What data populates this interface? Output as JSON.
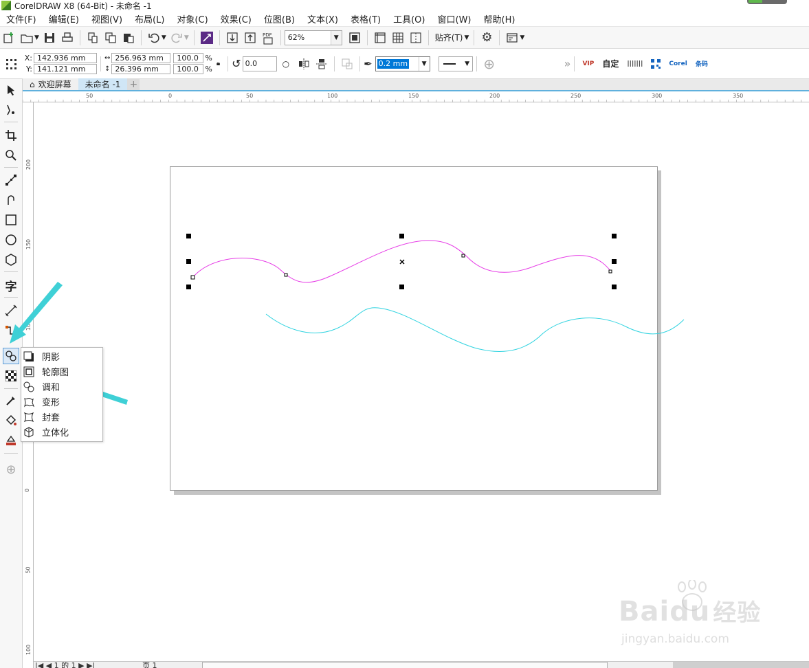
{
  "window": {
    "title": "CorelDRAW X8 (64-Bit) - 未命名 -1"
  },
  "menu": [
    "文件(F)",
    "编辑(E)",
    "视图(V)",
    "布局(L)",
    "对象(C)",
    "效果(C)",
    "位图(B)",
    "文本(X)",
    "表格(T)",
    "工具(O)",
    "窗口(W)",
    "帮助(H)"
  ],
  "toolbar": {
    "zoom": "62%",
    "snap_label": "贴齐(T)"
  },
  "properties": {
    "x_label": "X:",
    "x_value": "142.936 mm",
    "y_label": "Y:",
    "y_value": "141.121 mm",
    "width_value": "256.963 mm",
    "height_value": "26.396 mm",
    "scale_x": "100.0",
    "scale_y": "100.0",
    "percent": "%",
    "rotation": "0.0",
    "outline_width": "0.2 mm",
    "plugin_labels": [
      "VIP",
      "自定",
      "|||||||",
      "Corel",
      "条码"
    ]
  },
  "tabs": {
    "welcome": "欢迎屏幕",
    "document": "未命名 -1"
  },
  "rulers": {
    "h_ticks": [
      "50",
      "0",
      "50",
      "100",
      "150",
      "200",
      "250",
      "300",
      "350"
    ],
    "v_ticks": [
      "200",
      "150",
      "100",
      "50",
      "0",
      "50",
      "100"
    ]
  },
  "flyout": {
    "items": [
      {
        "label": "阴影",
        "icon": "drop-shadow-icon"
      },
      {
        "label": "轮廓图",
        "icon": "contour-icon"
      },
      {
        "label": "调和",
        "icon": "blend-icon"
      },
      {
        "label": "变形",
        "icon": "distort-icon"
      },
      {
        "label": "封套",
        "icon": "envelope-icon"
      },
      {
        "label": "立体化",
        "icon": "extrude-icon"
      }
    ]
  },
  "status": {
    "page_nav": "1 的 1",
    "page_tab": "页 1"
  },
  "watermark": {
    "brand": "Bai",
    "brand_suffix": "du",
    "brand_cn": "经验",
    "url": "jingyan.baidu.com"
  },
  "colors": {
    "magenta_curve": "#e63be6",
    "cyan_curve": "#2fd3e0",
    "arrow": "#3fd0d6",
    "selection": "#000000"
  }
}
